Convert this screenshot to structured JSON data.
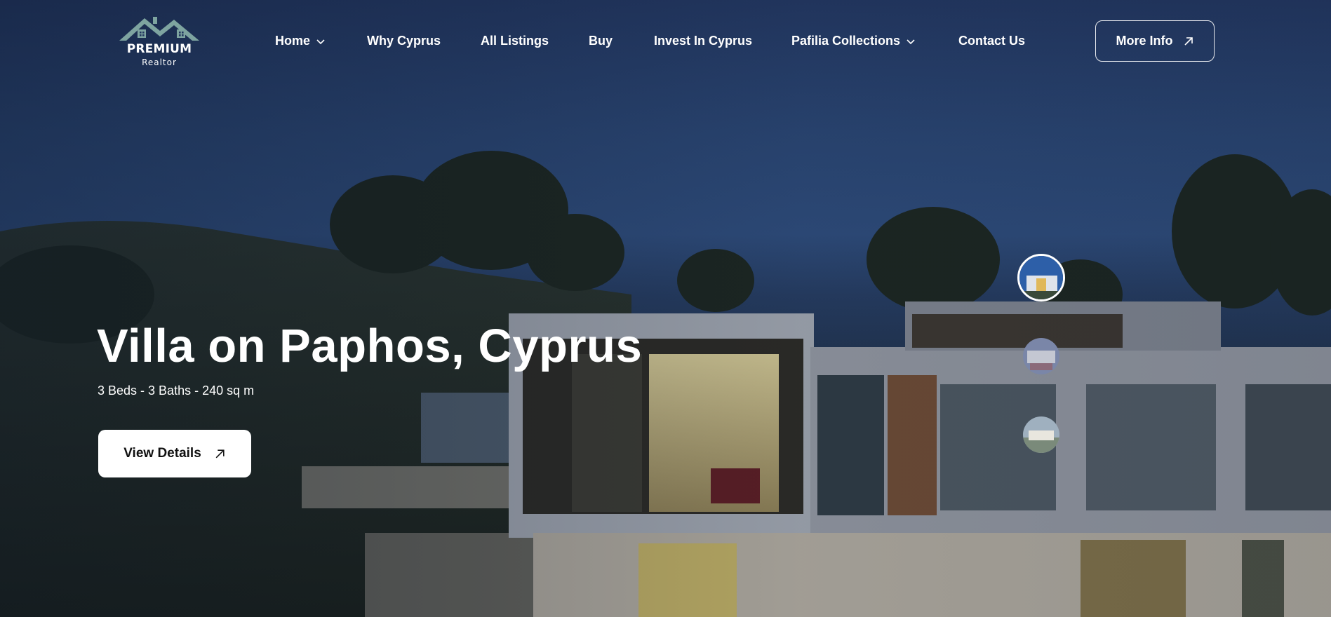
{
  "brand": {
    "name": "PREMIUM",
    "tagline": "Realtor",
    "logo_icon": "house-roof-icon",
    "logo_color": "#7ea4a0"
  },
  "nav": {
    "items": [
      {
        "label": "Home",
        "has_dropdown": true
      },
      {
        "label": "Why Cyprus",
        "has_dropdown": false
      },
      {
        "label": "All Listings",
        "has_dropdown": false
      },
      {
        "label": "Buy",
        "has_dropdown": false
      },
      {
        "label": "Invest In Cyprus",
        "has_dropdown": false
      },
      {
        "label": "Pafilia Collections",
        "has_dropdown": true
      },
      {
        "label": "Contact Us",
        "has_dropdown": false
      }
    ],
    "cta_label": "More Info",
    "cta_icon": "arrow-up-right-icon"
  },
  "hero": {
    "title": "Villa on Paphos, Cyprus",
    "specs": "3 Beds - 3 Baths - 240 sq m",
    "button_label": "View Details",
    "button_icon": "arrow-up-right-icon"
  },
  "gallery": {
    "thumbnails": [
      {
        "name": "villa-night-thumbnail",
        "active": true
      },
      {
        "name": "interior-thumbnail",
        "active": false
      },
      {
        "name": "exterior-pool-thumbnail",
        "active": false
      }
    ]
  },
  "colors": {
    "sky": "#2d4a78",
    "button_bg": "#ffffff",
    "text": "#ffffff"
  }
}
